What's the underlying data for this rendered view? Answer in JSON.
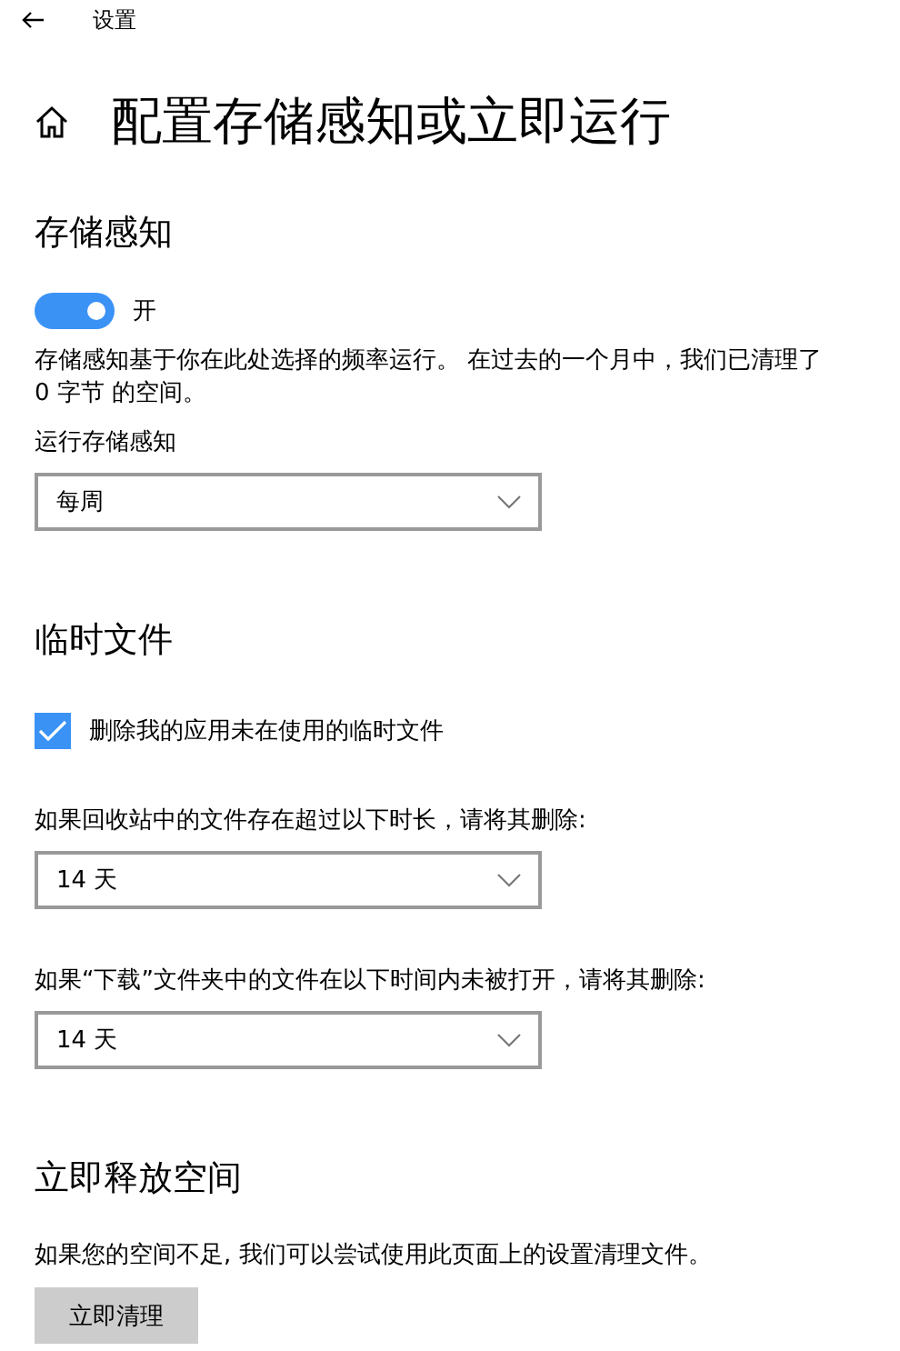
{
  "header": {
    "title": "设置"
  },
  "page_title": "配置存储感知或立即运行",
  "sections": [
    {
      "title": "存储感知",
      "items": [
        {
          "kind": "toggle",
          "on": true,
          "label": "开"
        },
        {
          "kind": "text",
          "text": "存储感知基于你在此处选择的频率运行。 在过去的一个月中，我们已清理了 0 字节 的空间。"
        },
        {
          "kind": "label",
          "text": "运行存储感知"
        },
        {
          "kind": "select",
          "value": "每周"
        }
      ]
    },
    {
      "title": "临时文件",
      "items": [
        {
          "kind": "checkbox",
          "checked": true,
          "label": "删除我的应用未在使用的临时文件"
        },
        {
          "kind": "label",
          "text": "如果回收站中的文件存在超过以下时长，请将其删除:"
        },
        {
          "kind": "select",
          "value": "14 天"
        },
        {
          "kind": "label",
          "text": "如果“下载”文件夹中的文件在以下时间内未被打开，请将其删除:"
        },
        {
          "kind": "select",
          "value": "14 天"
        }
      ]
    },
    {
      "title": "立即释放空间",
      "items": [
        {
          "kind": "text",
          "text": "如果您的空间不足, 我们可以尝试使用此页面上的设置清理文件。"
        },
        {
          "kind": "button",
          "label": "立即清理"
        }
      ]
    }
  ]
}
